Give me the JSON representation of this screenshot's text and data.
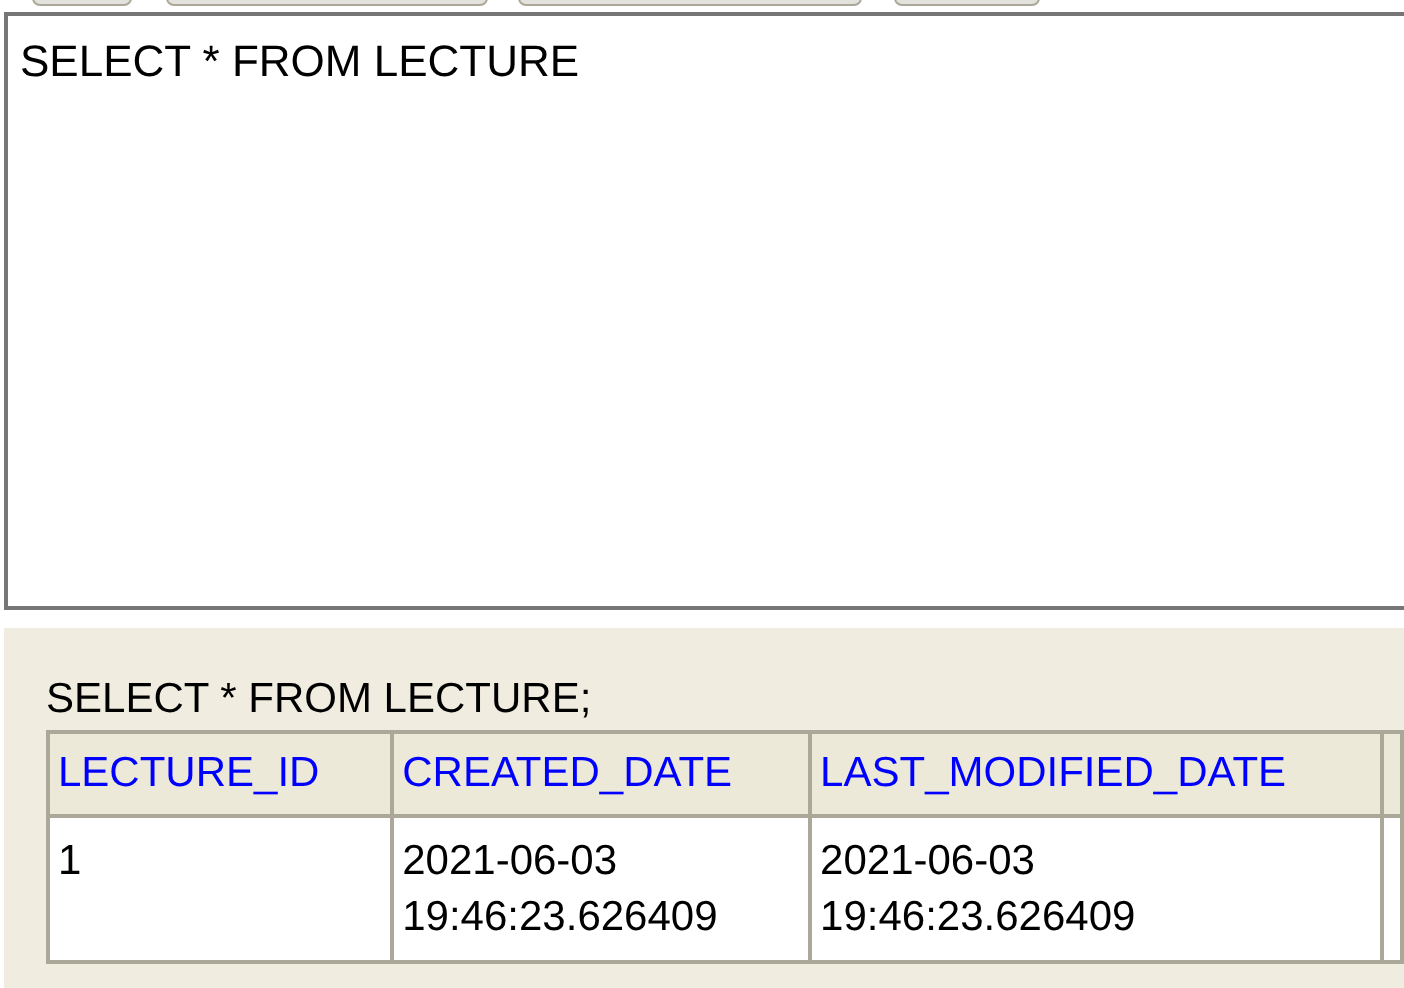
{
  "editor": {
    "value": "SELECT * FROM LECTURE"
  },
  "result": {
    "statement": "SELECT * FROM LECTURE;",
    "table": {
      "columns": [
        "LECTURE_ID",
        "CREATED_DATE",
        "LAST_MODIFIED_DATE"
      ],
      "rows": [
        [
          "1",
          "2021-06-03\n19:46:23.626409",
          "2021-06-03\n19:46:23.626409"
        ]
      ]
    }
  }
}
